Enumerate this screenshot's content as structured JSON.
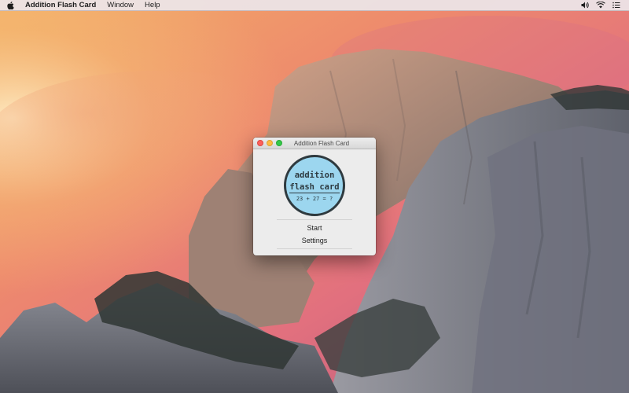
{
  "menubar": {
    "apple_icon": "apple-icon",
    "app_name": "Addition Flash Card",
    "items": [
      "Window",
      "Help"
    ],
    "status_icons": [
      "volume-icon",
      "wifi-icon",
      "list-icon"
    ]
  },
  "window": {
    "title": "Addition Flash Card",
    "logo": {
      "line1": "addition",
      "line2": "flash card",
      "line3": "23 + 27 = ?"
    },
    "buttons": {
      "start": "Start",
      "settings": "Settings"
    }
  },
  "colors": {
    "logo_fill": "#9cd6ef",
    "logo_border": "#2f3a3f",
    "close": "#fc605b",
    "minimize": "#fdbc40",
    "zoom": "#34c84a"
  }
}
